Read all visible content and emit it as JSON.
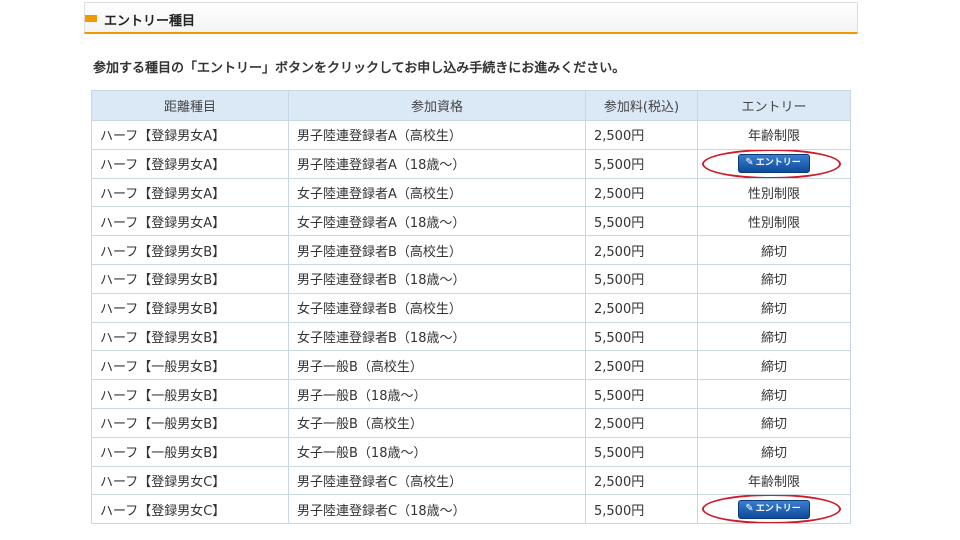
{
  "header": {
    "title": "エントリー種目"
  },
  "instruction": "参加する種目の「エントリー」ボタンをクリックしてお申し込み手続きにお進みください。",
  "table": {
    "columns": [
      "距離種目",
      "参加資格",
      "参加料(税込)",
      "エントリー"
    ],
    "rows": [
      {
        "event": "ハーフ【登録男女A】",
        "qual": "男子陸連登録者A（高校生）",
        "fee": "2,500円",
        "status": "年齢制限",
        "button": false
      },
      {
        "event": "ハーフ【登録男女A】",
        "qual": "男子陸連登録者A（18歳～）",
        "fee": "5,500円",
        "status": "エントリー",
        "button": true
      },
      {
        "event": "ハーフ【登録男女A】",
        "qual": "女子陸連登録者A（高校生）",
        "fee": "2,500円",
        "status": "性別制限",
        "button": false
      },
      {
        "event": "ハーフ【登録男女A】",
        "qual": "女子陸連登録者A（18歳～）",
        "fee": "5,500円",
        "status": "性別制限",
        "button": false
      },
      {
        "event": "ハーフ【登録男女B】",
        "qual": "男子陸連登録者B（高校生）",
        "fee": "2,500円",
        "status": "締切",
        "button": false
      },
      {
        "event": "ハーフ【登録男女B】",
        "qual": "男子陸連登録者B（18歳～）",
        "fee": "5,500円",
        "status": "締切",
        "button": false
      },
      {
        "event": "ハーフ【登録男女B】",
        "qual": "女子陸連登録者B（高校生）",
        "fee": "2,500円",
        "status": "締切",
        "button": false
      },
      {
        "event": "ハーフ【登録男女B】",
        "qual": "女子陸連登録者B（18歳～）",
        "fee": "5,500円",
        "status": "締切",
        "button": false
      },
      {
        "event": "ハーフ【一般男女B】",
        "qual": "男子一般B（高校生）",
        "fee": "2,500円",
        "status": "締切",
        "button": false
      },
      {
        "event": "ハーフ【一般男女B】",
        "qual": "男子一般B（18歳～）",
        "fee": "5,500円",
        "status": "締切",
        "button": false
      },
      {
        "event": "ハーフ【一般男女B】",
        "qual": "女子一般B（高校生）",
        "fee": "2,500円",
        "status": "締切",
        "button": false
      },
      {
        "event": "ハーフ【一般男女B】",
        "qual": "女子一般B（18歳～）",
        "fee": "5,500円",
        "status": "締切",
        "button": false
      },
      {
        "event": "ハーフ【登録男女C】",
        "qual": "男子陸連登録者C（高校生）",
        "fee": "2,500円",
        "status": "年齢制限",
        "button": false
      },
      {
        "event": "ハーフ【登録男女C】",
        "qual": "男子陸連登録者C（18歳～）",
        "fee": "5,500円",
        "status": "エントリー",
        "button": true
      }
    ]
  },
  "colors": {
    "accent": "#f39800",
    "header_bg": "#dbe9f7",
    "button": "#1a5cb0",
    "highlight": "#d01a2a"
  },
  "icons": {
    "entry_button_icon": "pencil-icon"
  }
}
